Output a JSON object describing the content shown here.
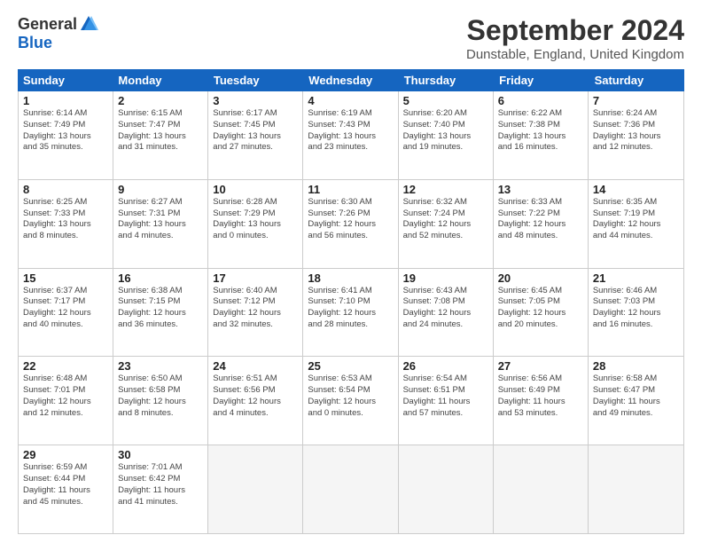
{
  "header": {
    "logo_general": "General",
    "logo_blue": "Blue",
    "title": "September 2024",
    "location": "Dunstable, England, United Kingdom"
  },
  "calendar": {
    "days_of_week": [
      "Sunday",
      "Monday",
      "Tuesday",
      "Wednesday",
      "Thursday",
      "Friday",
      "Saturday"
    ],
    "weeks": [
      [
        {
          "day": "",
          "empty": true
        },
        {
          "day": "",
          "empty": true
        },
        {
          "day": "",
          "empty": true
        },
        {
          "day": "",
          "empty": true
        },
        {
          "day": "",
          "empty": true
        },
        {
          "day": "",
          "empty": true
        },
        {
          "day": "",
          "empty": true
        }
      ],
      [
        {
          "day": "1",
          "info": "Sunrise: 6:14 AM\nSunset: 7:49 PM\nDaylight: 13 hours\nand 35 minutes."
        },
        {
          "day": "2",
          "info": "Sunrise: 6:15 AM\nSunset: 7:47 PM\nDaylight: 13 hours\nand 31 minutes."
        },
        {
          "day": "3",
          "info": "Sunrise: 6:17 AM\nSunset: 7:45 PM\nDaylight: 13 hours\nand 27 minutes."
        },
        {
          "day": "4",
          "info": "Sunrise: 6:19 AM\nSunset: 7:43 PM\nDaylight: 13 hours\nand 23 minutes."
        },
        {
          "day": "5",
          "info": "Sunrise: 6:20 AM\nSunset: 7:40 PM\nDaylight: 13 hours\nand 19 minutes."
        },
        {
          "day": "6",
          "info": "Sunrise: 6:22 AM\nSunset: 7:38 PM\nDaylight: 13 hours\nand 16 minutes."
        },
        {
          "day": "7",
          "info": "Sunrise: 6:24 AM\nSunset: 7:36 PM\nDaylight: 13 hours\nand 12 minutes."
        }
      ],
      [
        {
          "day": "8",
          "info": "Sunrise: 6:25 AM\nSunset: 7:33 PM\nDaylight: 13 hours\nand 8 minutes."
        },
        {
          "day": "9",
          "info": "Sunrise: 6:27 AM\nSunset: 7:31 PM\nDaylight: 13 hours\nand 4 minutes."
        },
        {
          "day": "10",
          "info": "Sunrise: 6:28 AM\nSunset: 7:29 PM\nDaylight: 13 hours\nand 0 minutes."
        },
        {
          "day": "11",
          "info": "Sunrise: 6:30 AM\nSunset: 7:26 PM\nDaylight: 12 hours\nand 56 minutes."
        },
        {
          "day": "12",
          "info": "Sunrise: 6:32 AM\nSunset: 7:24 PM\nDaylight: 12 hours\nand 52 minutes."
        },
        {
          "day": "13",
          "info": "Sunrise: 6:33 AM\nSunset: 7:22 PM\nDaylight: 12 hours\nand 48 minutes."
        },
        {
          "day": "14",
          "info": "Sunrise: 6:35 AM\nSunset: 7:19 PM\nDaylight: 12 hours\nand 44 minutes."
        }
      ],
      [
        {
          "day": "15",
          "info": "Sunrise: 6:37 AM\nSunset: 7:17 PM\nDaylight: 12 hours\nand 40 minutes."
        },
        {
          "day": "16",
          "info": "Sunrise: 6:38 AM\nSunset: 7:15 PM\nDaylight: 12 hours\nand 36 minutes."
        },
        {
          "day": "17",
          "info": "Sunrise: 6:40 AM\nSunset: 7:12 PM\nDaylight: 12 hours\nand 32 minutes."
        },
        {
          "day": "18",
          "info": "Sunrise: 6:41 AM\nSunset: 7:10 PM\nDaylight: 12 hours\nand 28 minutes."
        },
        {
          "day": "19",
          "info": "Sunrise: 6:43 AM\nSunset: 7:08 PM\nDaylight: 12 hours\nand 24 minutes."
        },
        {
          "day": "20",
          "info": "Sunrise: 6:45 AM\nSunset: 7:05 PM\nDaylight: 12 hours\nand 20 minutes."
        },
        {
          "day": "21",
          "info": "Sunrise: 6:46 AM\nSunset: 7:03 PM\nDaylight: 12 hours\nand 16 minutes."
        }
      ],
      [
        {
          "day": "22",
          "info": "Sunrise: 6:48 AM\nSunset: 7:01 PM\nDaylight: 12 hours\nand 12 minutes."
        },
        {
          "day": "23",
          "info": "Sunrise: 6:50 AM\nSunset: 6:58 PM\nDaylight: 12 hours\nand 8 minutes."
        },
        {
          "day": "24",
          "info": "Sunrise: 6:51 AM\nSunset: 6:56 PM\nDaylight: 12 hours\nand 4 minutes."
        },
        {
          "day": "25",
          "info": "Sunrise: 6:53 AM\nSunset: 6:54 PM\nDaylight: 12 hours\nand 0 minutes."
        },
        {
          "day": "26",
          "info": "Sunrise: 6:54 AM\nSunset: 6:51 PM\nDaylight: 11 hours\nand 57 minutes."
        },
        {
          "day": "27",
          "info": "Sunrise: 6:56 AM\nSunset: 6:49 PM\nDaylight: 11 hours\nand 53 minutes."
        },
        {
          "day": "28",
          "info": "Sunrise: 6:58 AM\nSunset: 6:47 PM\nDaylight: 11 hours\nand 49 minutes."
        }
      ],
      [
        {
          "day": "29",
          "info": "Sunrise: 6:59 AM\nSunset: 6:44 PM\nDaylight: 11 hours\nand 45 minutes."
        },
        {
          "day": "30",
          "info": "Sunrise: 7:01 AM\nSunset: 6:42 PM\nDaylight: 11 hours\nand 41 minutes."
        },
        {
          "day": "",
          "empty": true
        },
        {
          "day": "",
          "empty": true
        },
        {
          "day": "",
          "empty": true
        },
        {
          "day": "",
          "empty": true
        },
        {
          "day": "",
          "empty": true
        }
      ]
    ]
  }
}
